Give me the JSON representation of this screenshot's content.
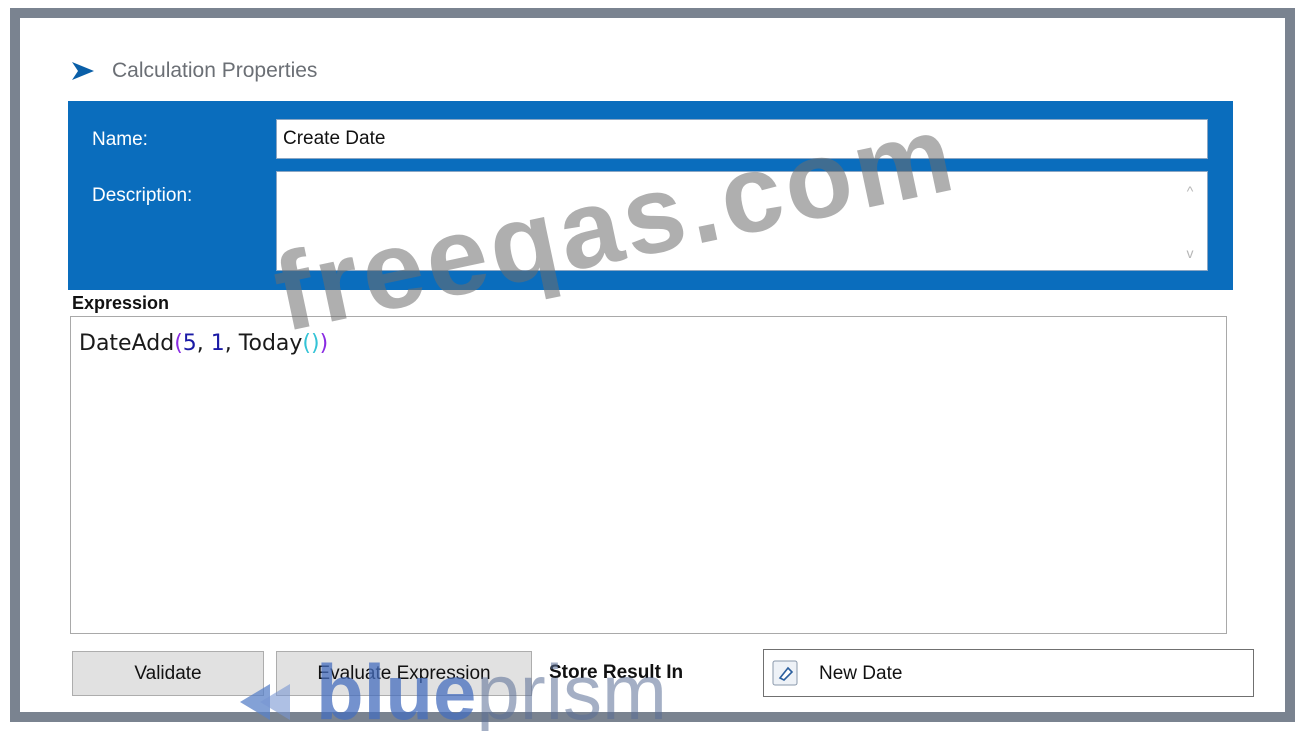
{
  "dialog": {
    "title": "Calculation Properties",
    "title_icon": "blueprism-logo-icon"
  },
  "form": {
    "name_label": "Name:",
    "name_value": "Create Date",
    "description_label": "Description:",
    "description_value": ""
  },
  "expression": {
    "label": "Expression",
    "tokens": {
      "fn": "DateAdd",
      "open": "(",
      "arg1": "5",
      "sep1": ", ",
      "arg2": "1",
      "sep2": ", ",
      "inner_fn": "Today",
      "inner_parens": "()",
      "close": ")"
    }
  },
  "footer": {
    "validate_label": "Validate",
    "evaluate_label": "Evaluate Expression",
    "store_label": "Store Result In",
    "store_value": "New Date",
    "store_icon": "data-item-icon"
  },
  "watermarks": {
    "site": "freeqas.com",
    "brand_bold": "blue",
    "brand_light": "prism"
  },
  "colors": {
    "header_blue": "#0a6dbd",
    "frame_gray": "#7a8390"
  }
}
